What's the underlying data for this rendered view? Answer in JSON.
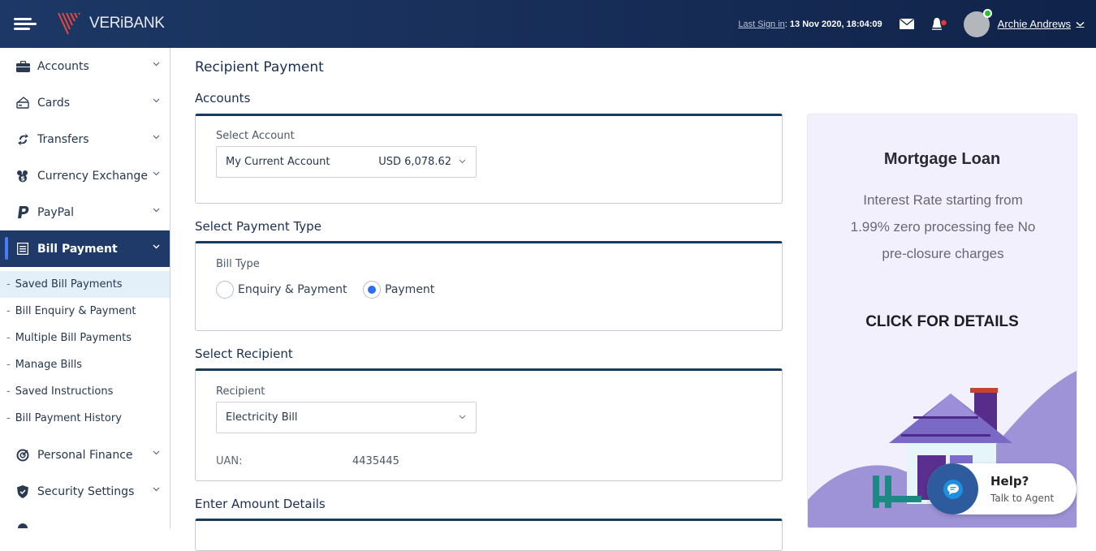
{
  "header": {
    "brand": "VERiBANK",
    "last_sign_in_label": "Last Sign in",
    "last_sign_in_value": "13 Nov 2020, 18:04:09",
    "user_name": "Archie Andrews",
    "icons": [
      "menu-icon",
      "mail-icon",
      "bell-icon",
      "avatar",
      "chevron-down-icon"
    ],
    "notification_dot_color": "#e53935",
    "online_color": "#2ac22a"
  },
  "sidebar": {
    "items": [
      {
        "label": "Accounts",
        "icon": "briefcase-icon"
      },
      {
        "label": "Cards",
        "icon": "card-icon"
      },
      {
        "label": "Transfers",
        "icon": "transfer-icon"
      },
      {
        "label": "Currency Exchange",
        "icon": "currency-icon"
      },
      {
        "label": "PayPal",
        "icon": "paypal-icon"
      },
      {
        "label": "Bill Payment",
        "icon": "bill-icon",
        "active": true
      },
      {
        "label": "Personal Finance",
        "icon": "target-icon"
      },
      {
        "label": "Security Settings",
        "icon": "shield-icon"
      }
    ],
    "sub_items": [
      {
        "label": "Saved Bill Payments",
        "selected": true
      },
      {
        "label": "Bill Enquiry & Payment"
      },
      {
        "label": "Multiple Bill Payments"
      },
      {
        "label": "Manage Bills"
      },
      {
        "label": "Saved Instructions"
      },
      {
        "label": "Bill Payment History"
      }
    ],
    "accent_color": "#1f3a68"
  },
  "main": {
    "page_title": "Recipient Payment",
    "accounts": {
      "section_title": "Accounts",
      "field_label": "Select Account",
      "selected_account": "My Current Account",
      "selected_balance": "USD 6,078.62"
    },
    "payment_type": {
      "section_title": "Select Payment Type",
      "field_label": "Bill Type",
      "options": [
        {
          "label": "Enquiry & Payment",
          "checked": false
        },
        {
          "label": "Payment",
          "checked": true
        }
      ]
    },
    "recipient": {
      "section_title": "Select Recipient",
      "field_label": "Recipient",
      "selected": "Electricity Bill",
      "uan_label": "UAN:",
      "uan_value": "4435445"
    },
    "amount": {
      "section_title": "Enter Amount Details"
    }
  },
  "promo": {
    "title": "Mortgage Loan",
    "body": "Interest Rate starting from 1.99% zero processing fee No pre-closure charges",
    "cta": "CLICK FOR DETAILS"
  },
  "help_widget": {
    "title": "Help?",
    "subtitle": "Talk to Agent"
  }
}
